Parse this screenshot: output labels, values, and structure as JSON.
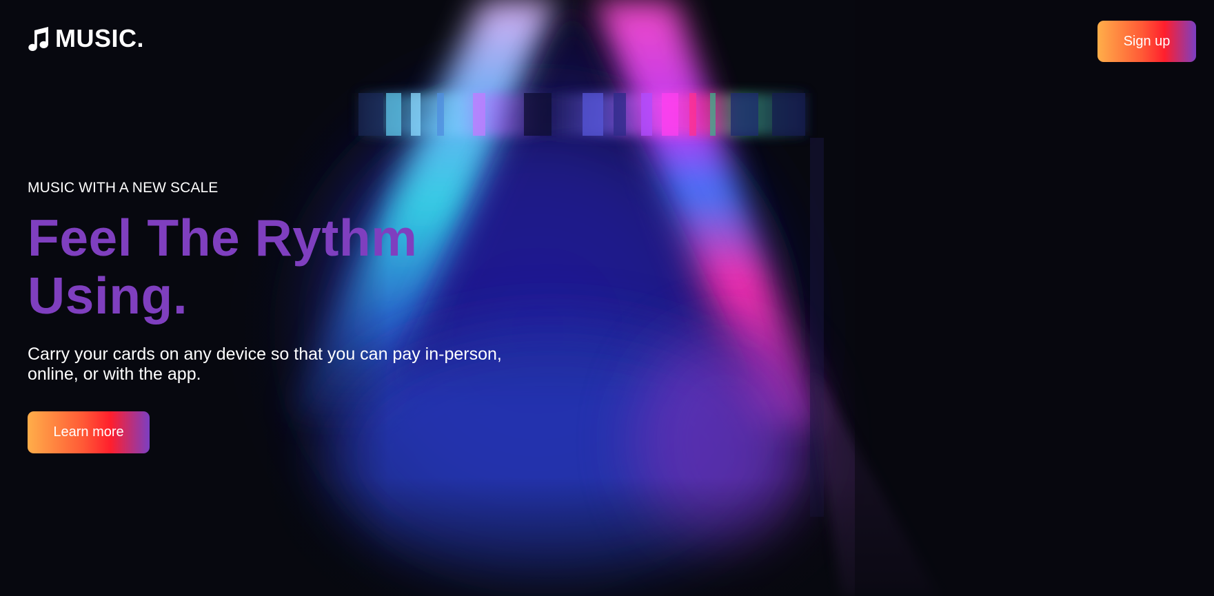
{
  "brand": {
    "logo_icon": "music-note-icon",
    "name": "MUSIC."
  },
  "nav": {
    "signup_label": "Sign up"
  },
  "hero": {
    "eyebrow": "MUSIC WITH A NEW SCALE",
    "headline_line1": "Feel The Rythm",
    "headline_line2": "Using.",
    "description": "Carry your cards on any device so that you can pay in-person, online, or with the app.",
    "cta_label": "Learn more"
  },
  "colors": {
    "background": "#07080f",
    "headline": "#7f3fbf",
    "button_gradient": [
      "#ffae4a",
      "#ff1f2d",
      "#7b3fc3"
    ]
  }
}
